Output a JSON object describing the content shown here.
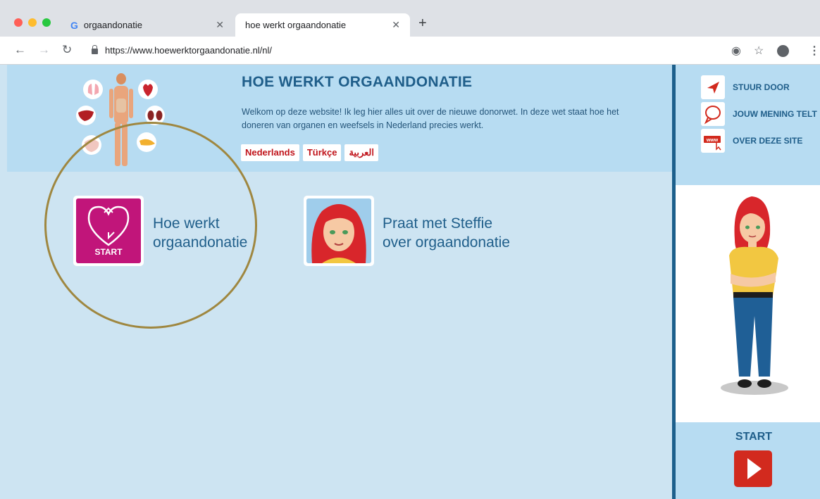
{
  "browser": {
    "tabs": [
      {
        "label": "orgaandonatie",
        "favicon": "google-g-icon",
        "active": false
      },
      {
        "label": "hoe werkt orgaandonatie",
        "active": true
      }
    ],
    "url": "https://www.hoewerktorgaandonatie.nl/nl/"
  },
  "site": {
    "title": "HOE WERKT ORGAANDONATIE",
    "intro_line1": "Welkom op deze website! Ik leg hier alles uit over de nieuwe donorwet. In deze wet staat hoe het",
    "intro_line2": "doneren van organen en weefsels in Nederland precies werkt.",
    "languages": [
      "Nederlands",
      "Türkçe",
      "العربية"
    ]
  },
  "tiles": [
    {
      "icon_label": "START",
      "line1": "Hoe werkt",
      "line2": "orgaandonatie"
    },
    {
      "line1": "Praat met Steffie",
      "line2": "over orgaandonatie"
    }
  ],
  "sidebar": {
    "items": [
      {
        "label": "STUUR DOOR",
        "icon": "paper-plane-icon"
      },
      {
        "label": "JOUW MENING TELT",
        "icon": "speech-bubble-icon"
      },
      {
        "label": "OVER DEZE SITE",
        "icon": "www-icon"
      }
    ],
    "start_label": "START"
  },
  "colors": {
    "header_blue": "#b7dcf2",
    "page_blue": "#cde4f2",
    "title_blue": "#1f5e8a",
    "magenta": "#c1157a",
    "red": "#d22a1e",
    "annotation_gold": "#9f8740"
  }
}
